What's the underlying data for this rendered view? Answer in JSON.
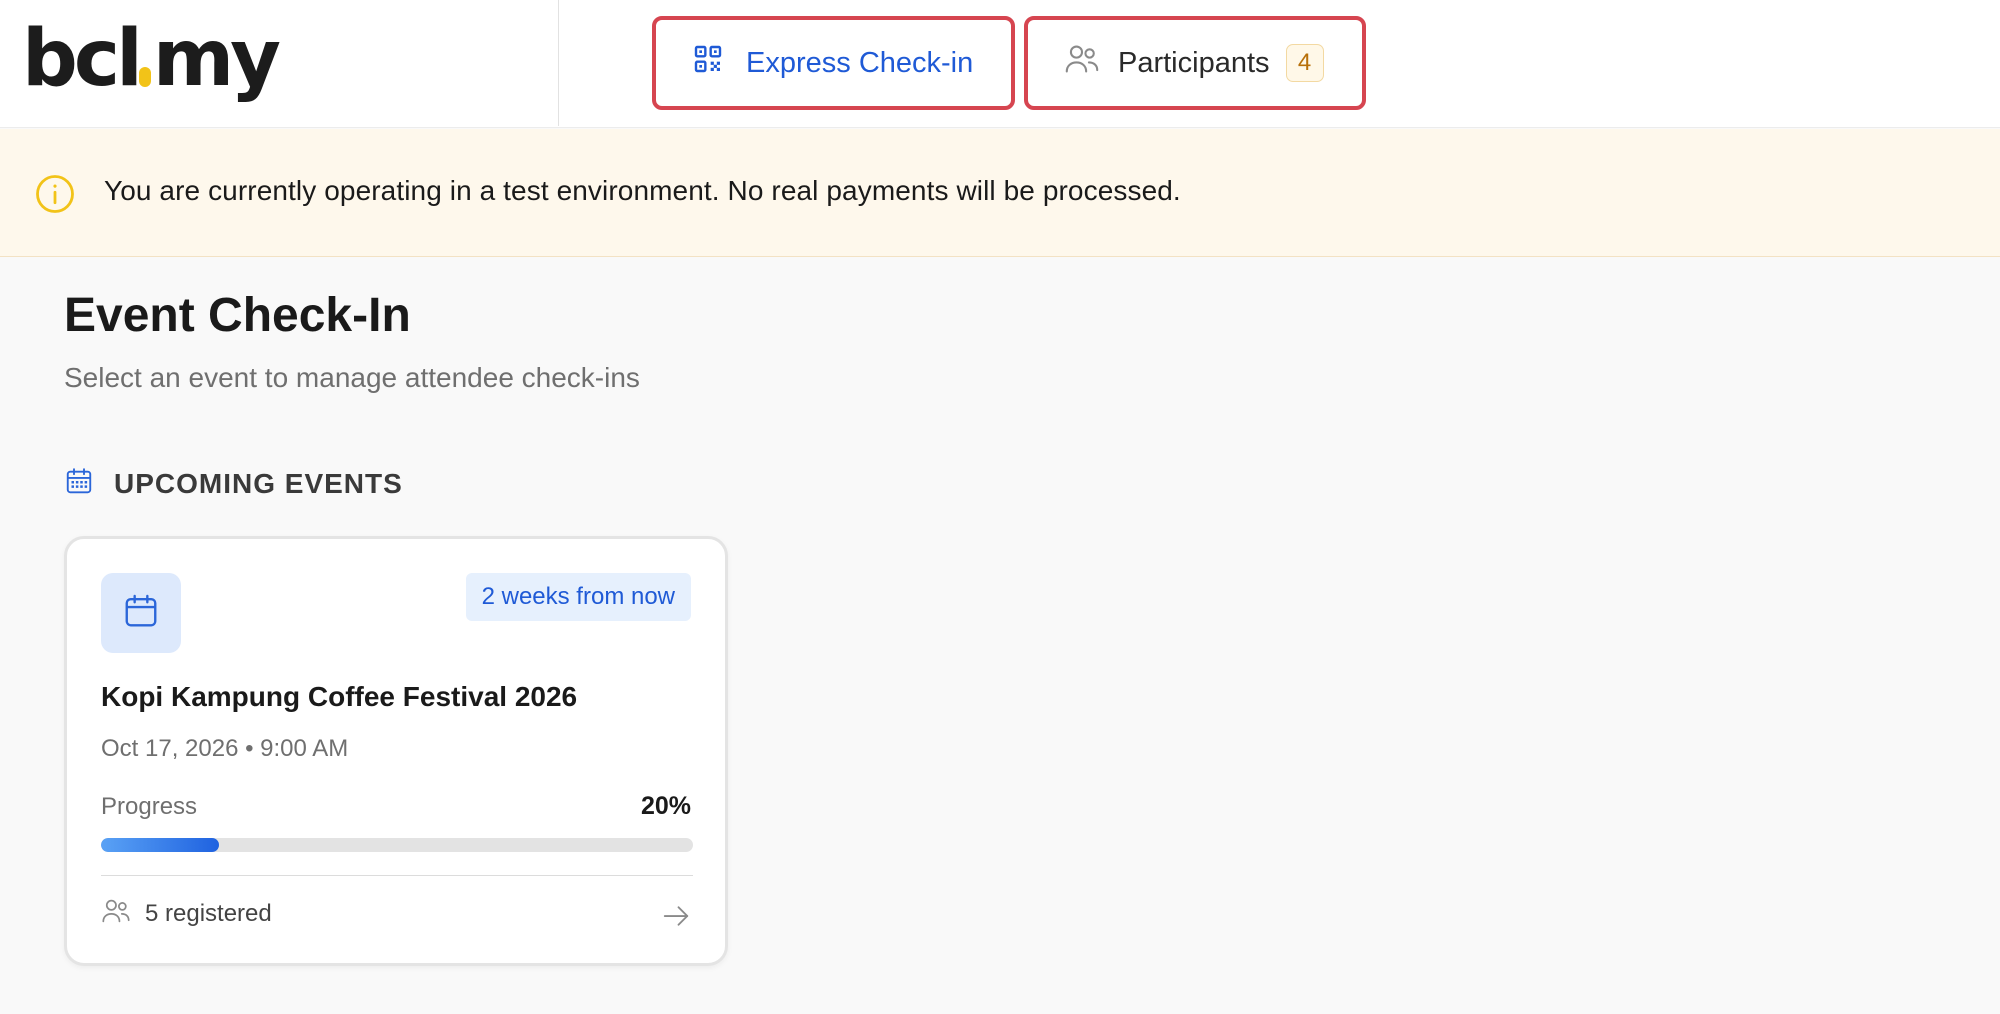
{
  "header": {
    "logo_left": "bcl",
    "logo_right": "my",
    "nav": {
      "express_checkin_label": "Express Check-in",
      "participants_label": "Participants",
      "participants_count": "4"
    }
  },
  "banner": {
    "message": "You are currently operating in a test environment. No real payments will be processed."
  },
  "page": {
    "title": "Event Check-In",
    "subtitle": "Select an event to manage attendee check-ins"
  },
  "upcoming": {
    "section_label": "UPCOMING EVENTS",
    "events": [
      {
        "relative_time": "2 weeks from now",
        "title": "Kopi Kampung Coffee Festival 2026",
        "date_time": "Oct 17, 2026 • 9:00 AM",
        "progress_label": "Progress",
        "progress_text": "20%",
        "progress_fraction": 0.2,
        "registered_text": "5 registered"
      }
    ]
  },
  "icons": {
    "express": "qr-code-icon",
    "participants": "users-icon",
    "banner": "info-icon",
    "section": "calendar-icon",
    "card_tile": "calendar-icon",
    "registered": "users-icon",
    "card_go": "arrow-right-icon"
  },
  "colors": {
    "accent": "#1f5ad6",
    "highlight_border": "#d64550",
    "banner_bg": "#fef8ec",
    "warning": "#f2c318",
    "logo_dot": "#f2c318"
  }
}
